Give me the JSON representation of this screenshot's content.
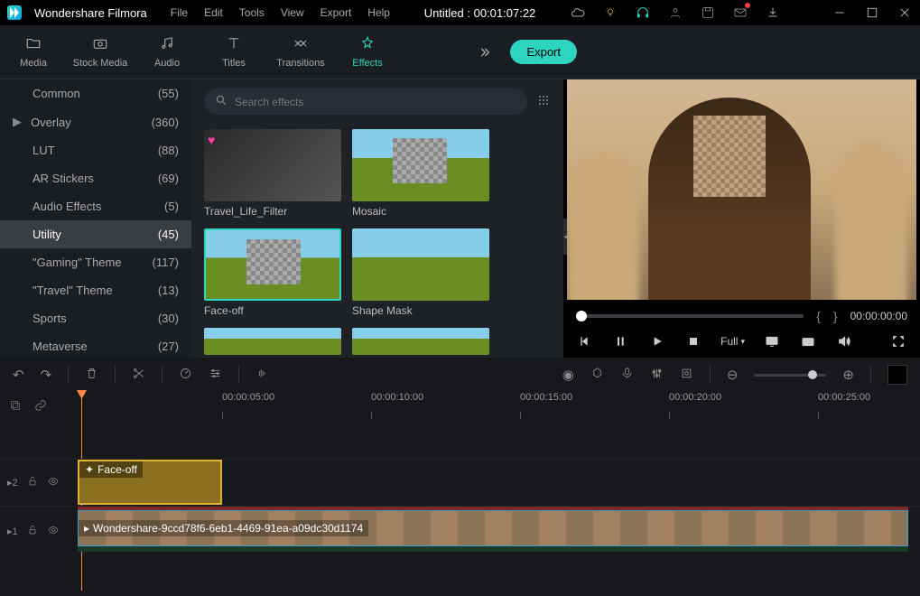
{
  "app": {
    "name": "Wondershare Filmora"
  },
  "menu": [
    "File",
    "Edit",
    "Tools",
    "View",
    "Export",
    "Help"
  ],
  "document": {
    "title": "Untitled : 00:01:07:22"
  },
  "tabs": [
    {
      "label": "Media"
    },
    {
      "label": "Stock Media"
    },
    {
      "label": "Audio"
    },
    {
      "label": "Titles"
    },
    {
      "label": "Transitions"
    },
    {
      "label": "Effects",
      "active": true
    }
  ],
  "export_btn": "Export",
  "sidebar": [
    {
      "label": "Common",
      "count": "(55)"
    },
    {
      "label": "Overlay",
      "count": "(360)",
      "arrow": true
    },
    {
      "label": "LUT",
      "count": "(88)"
    },
    {
      "label": "AR Stickers",
      "count": "(69)"
    },
    {
      "label": "Audio Effects",
      "count": "(5)"
    },
    {
      "label": "Utility",
      "count": "(45)",
      "selected": true
    },
    {
      "label": "\"Gaming\" Theme",
      "count": "(117)"
    },
    {
      "label": "\"Travel\" Theme",
      "count": "(13)"
    },
    {
      "label": "Sports",
      "count": "(30)"
    },
    {
      "label": "Metaverse",
      "count": "(27)"
    }
  ],
  "search": {
    "placeholder": "Search effects"
  },
  "effects": [
    {
      "label": "Travel_Life_Filter",
      "heart": true
    },
    {
      "label": "Mosaic"
    },
    {
      "label": "Face-off",
      "selected": true
    },
    {
      "label": "Shape Mask"
    }
  ],
  "preview": {
    "quality": "Full",
    "timecode": "00:00:00:00"
  },
  "ruler": [
    {
      "label": "00:00:05:00"
    },
    {
      "label": "00:00:10:00"
    },
    {
      "label": "00:00:15:00"
    },
    {
      "label": "00:00:20:00"
    },
    {
      "label": "00:00:25:00"
    }
  ],
  "tracks": {
    "t2": "2",
    "t1": "1",
    "effect_clip": "Face-off",
    "video_clip": "Wondershare-9ccd78f6-6eb1-4469-91ea-a09dc30d1174"
  }
}
